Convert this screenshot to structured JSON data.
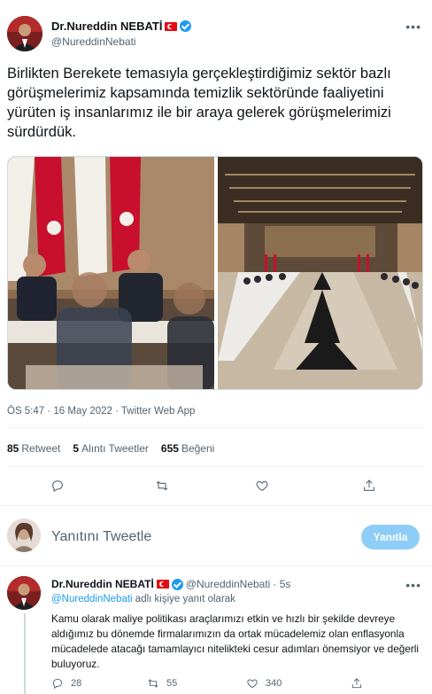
{
  "main_tweet": {
    "author_name": "Dr.Nureddin NEBATİ",
    "author_handle": "@NureddinNebati",
    "more_label": "•••",
    "text": "Birlikten Berekete temasıyla gerçekleştirdiğimiz sektör bazlı görüşmelerimiz kapsamında temizlik sektöründe faaliyetini yürüten iş insanlarımız ile bir araya gelerek görüşmelerimizi sürdürdük.",
    "timestamp": "ÖS 5:47 · 16 May 2022 · Twitter Web App",
    "stats": {
      "retweet_count": "85",
      "retweet_label": "Retweet",
      "quote_count": "5",
      "quote_label": "Alıntı Tweetler",
      "like_count": "655",
      "like_label": "Beğeni"
    },
    "actions": [
      "reply-icon",
      "retweet-icon",
      "like-icon",
      "share-icon"
    ]
  },
  "reply_box": {
    "placeholder": "Yanıtını Tweetle",
    "button_label": "Yanıtla"
  },
  "reply_tweet": {
    "author_name": "Dr.Nureddin NEBATİ",
    "author_handle": "@NureddinNebati",
    "time": "· 5s",
    "more_label": "•••",
    "replying_link": "@NureddinNebati",
    "replying_suffix": "adlı kişiye yanıt olarak",
    "text": "Kamu olarak maliye politikası araçlarımızı etkin ve hızlı bir şekilde devreye aldığımız bu dönemde firmalarımızın da ortak mücadelemiz olan enflasyonla mücadelede atacağı tamamlayıcı nitelikteki cesur adımları önemsiyor ve değerli buluyoruz.",
    "reply_count": "28",
    "retweet_count": "55",
    "like_count": "340"
  },
  "colors": {
    "accent": "#1d9bf0",
    "button_disabled": "#8ecdf8",
    "secondary_text": "#536471"
  }
}
